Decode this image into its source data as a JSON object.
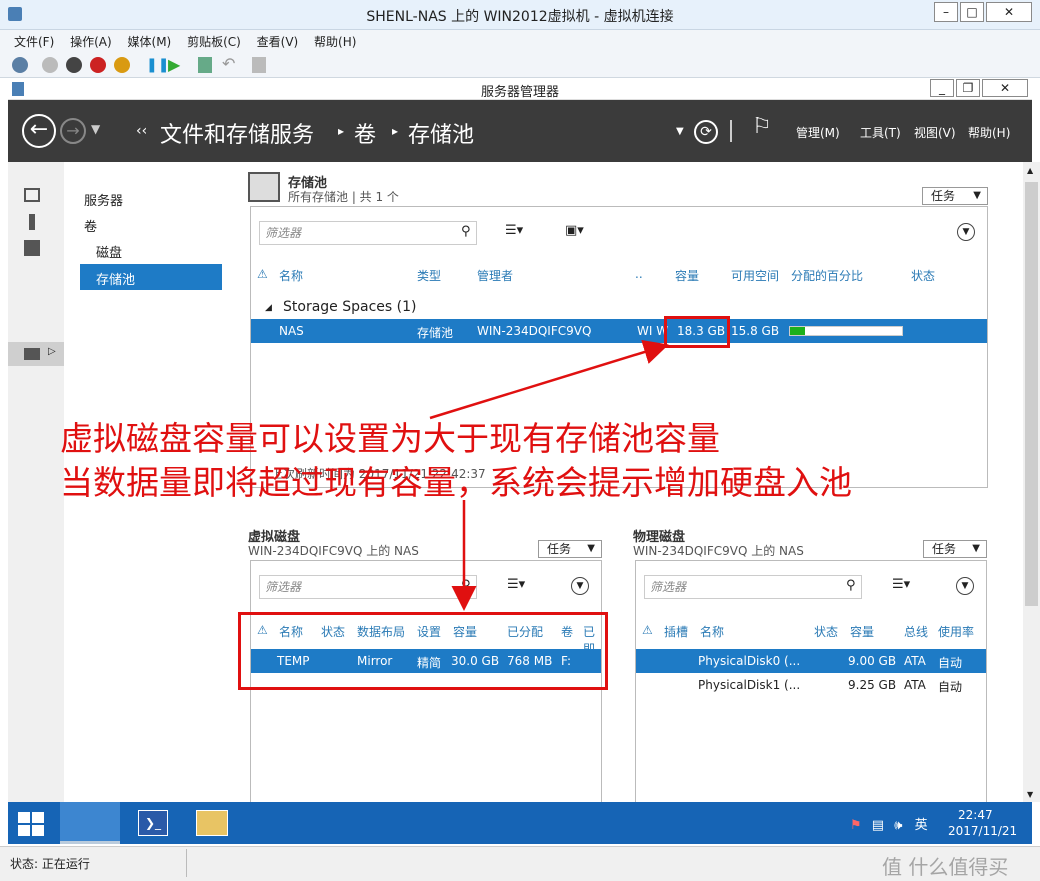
{
  "host": {
    "title": "SHENL-NAS 上的 WIN2012虚拟机 - 虚拟机连接",
    "menu": [
      "文件(F)",
      "操作(A)",
      "媒体(M)",
      "剪贴板(C)",
      "查看(V)",
      "帮助(H)"
    ]
  },
  "guest": {
    "app_title": "服务器管理器",
    "breadcrumb": [
      "文件和存储服务",
      "卷",
      "存储池"
    ],
    "header_menu": [
      "管理(M)",
      "工具(T)",
      "视图(V)",
      "帮助(H)"
    ],
    "nav": {
      "items": [
        "服务器",
        "卷",
        "磁盘",
        "存储池"
      ]
    },
    "pool": {
      "title": "存储池",
      "subtitle": "所有存储池 | 共 1 个",
      "tasks": "任务",
      "filter_placeholder": "筛选器",
      "columns": [
        "名称",
        "类型",
        "管理者",
        "..",
        "容量",
        "可用空间",
        "分配的百分比",
        "状态"
      ],
      "group": "Storage Spaces (1)",
      "row": {
        "name": "NAS",
        "type": "存储池",
        "manager": "WIN-234DQIFC9VQ",
        "extra": "WI W",
        "capacity": "18.3 GB",
        "free": "15.8 GB"
      },
      "alloc_pct": 0.13,
      "refresh": "上次刷新时间为 2017/11/21 22:42:37"
    },
    "vdisk": {
      "title": "虚拟磁盘",
      "subtitle": "WIN-234DQIFC9VQ 上的 NAS",
      "tasks": "任务",
      "filter_placeholder": "筛选器",
      "columns": [
        "名称",
        "状态",
        "数据布局",
        "设置",
        "容量",
        "已分配",
        "卷",
        "已即"
      ],
      "row": {
        "name": "TEMP",
        "status": "",
        "layout": "Mirror",
        "setting": "精简",
        "capacity": "30.0 GB",
        "allocated": "768 MB",
        "volume": "F:"
      }
    },
    "pdisk": {
      "title": "物理磁盘",
      "subtitle": "WIN-234DQIFC9VQ 上的 NAS",
      "tasks": "任务",
      "filter_placeholder": "筛选器",
      "columns": [
        "插槽",
        "名称",
        "状态",
        "容量",
        "总线",
        "使用率"
      ],
      "rows": [
        {
          "name": "PhysicalDisk0 (...",
          "capacity": "9.00 GB",
          "bus": "ATA",
          "usage": "自动"
        },
        {
          "name": "PhysicalDisk1 (...",
          "capacity": "9.25 GB",
          "bus": "ATA",
          "usage": "自动"
        }
      ]
    },
    "clock": {
      "time": "22:47",
      "date": "2017/11/21"
    },
    "ime": "英"
  },
  "annotation": {
    "line1": "虚拟磁盘容量可以设置为大于现有存储池容量",
    "line2": "当数据量即将超过现有容量，系统会提示增加硬盘入池"
  },
  "status": "状态: 正在运行",
  "watermark": "值 什么值得买",
  "colors": {
    "accent": "#1e7bc6",
    "annotation": "#e01010",
    "header": "#3b3b3b",
    "taskbar": "#1664b5"
  }
}
